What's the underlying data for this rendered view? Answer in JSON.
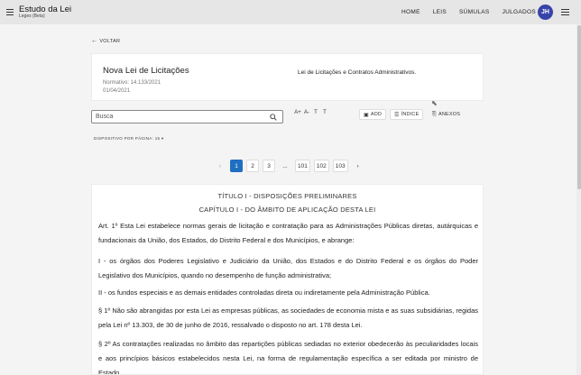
{
  "app": {
    "title": "Estudo da Lei",
    "subtitle": "Leges (Beta)",
    "nav": [
      "HOME",
      "LEIS",
      "SÚMULAS",
      "JULGADOS"
    ],
    "avatar_initials": "JH",
    "accent_color": "#3843a8"
  },
  "back_label": "VOLTAR",
  "law": {
    "title": "Nova Lei de Licitações",
    "normativo": "Normativo: 14.133/2021",
    "date": "01/04/2021",
    "description": "Lei de Licitações e Contratos Administrativos."
  },
  "search": {
    "placeholder": "Busca"
  },
  "font_controls": [
    "A+",
    "A-",
    "T",
    "T"
  ],
  "tools": {
    "add": "ADD",
    "index": "ÍNDICE",
    "attachments": "ANEXOS"
  },
  "per_page": {
    "label": "DISPOSITIVO POR PÁGINA:",
    "value": "15"
  },
  "pagination": {
    "pages": [
      "1",
      "2",
      "3",
      "...",
      "101",
      "102",
      "103"
    ],
    "current": "1",
    "active_color": "#1e6fc2"
  },
  "document": {
    "title": "TÍTULO I - DISPOSIÇÕES PRELIMINARES",
    "chapter": "CAPÍTULO I - DO ÂMBITO DE APLICAÇÃO DESTA LEI",
    "paragraphs": [
      "Art. 1º Esta Lei estabelece normas gerais de licitação e contratação para as Administrações Públicas diretas, autárquicas e fundacionais da União, dos Estados, do Distrito Federal e dos Municípios, e abrange:",
      "I - os órgãos dos Poderes Legislativo e Judiciário da União, dos Estados e do Distrito Federal e os órgãos do Poder Legislativo dos Municípios, quando no desempenho de função administrativa;",
      "II - os fundos especiais e as demais entidades controladas direta ou indiretamente pela Administração Pública.",
      "§ 1º Não são abrangidas por esta Lei as empresas públicas, as sociedades de economia mista e as suas subsidiárias, regidas pela Lei nº 13.303, de 30 de junho de 2016, ressalvado o disposto no art. 178 desta Lei.",
      "§ 2º As contratações realizadas no âmbito das repartições públicas sediadas no exterior obedecerão às peculiaridades locais e aos princípios básicos estabelecidos nesta Lei, na forma de regulamentação específica a ser editada por ministro de Estado."
    ]
  }
}
